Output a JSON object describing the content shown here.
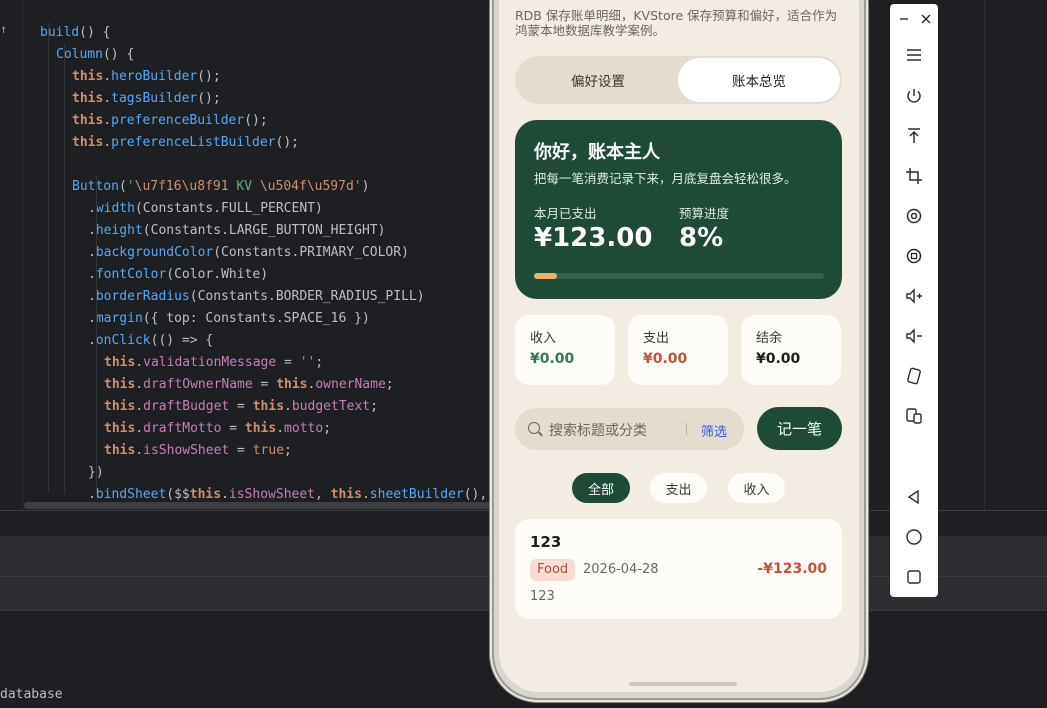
{
  "ide": {
    "code_lines": [
      {
        "indent": 0,
        "tokens": [
          [
            "fn",
            "build"
          ],
          [
            "pl",
            "() {"
          ]
        ]
      },
      {
        "indent": 1,
        "tokens": [
          [
            "fn",
            "Column"
          ],
          [
            "pl",
            "() {"
          ]
        ]
      },
      {
        "indent": 2,
        "tokens": [
          [
            "this",
            "this"
          ],
          [
            "pl",
            "."
          ],
          [
            "fn",
            "heroBuilder"
          ],
          [
            "pl",
            "();"
          ]
        ]
      },
      {
        "indent": 2,
        "tokens": [
          [
            "this",
            "this"
          ],
          [
            "pl",
            "."
          ],
          [
            "fn",
            "tagsBuilder"
          ],
          [
            "pl",
            "();"
          ]
        ]
      },
      {
        "indent": 2,
        "tokens": [
          [
            "this",
            "this"
          ],
          [
            "pl",
            "."
          ],
          [
            "fn",
            "preferenceBuilder"
          ],
          [
            "pl",
            "();"
          ]
        ]
      },
      {
        "indent": 2,
        "tokens": [
          [
            "this",
            "this"
          ],
          [
            "pl",
            "."
          ],
          [
            "fn",
            "preferenceListBuilder"
          ],
          [
            "pl",
            "();"
          ]
        ]
      },
      {
        "indent": 2,
        "tokens": []
      },
      {
        "indent": 2,
        "tokens": [
          [
            "fn",
            "Button"
          ],
          [
            "pl",
            "("
          ],
          [
            "str",
            "'"
          ],
          [
            "esc",
            "\\u7f16\\u8f91"
          ],
          [
            "str",
            " KV "
          ],
          [
            "esc",
            "\\u504f\\u597d"
          ],
          [
            "str",
            "'"
          ],
          [
            "pl",
            ")"
          ]
        ]
      },
      {
        "indent": 3,
        "tokens": [
          [
            "pl",
            "."
          ],
          [
            "fn",
            "width"
          ],
          [
            "pl",
            "(Constants.FULL_PERCENT)"
          ]
        ]
      },
      {
        "indent": 3,
        "tokens": [
          [
            "pl",
            "."
          ],
          [
            "fn",
            "height"
          ],
          [
            "pl",
            "(Constants.LARGE_BUTTON_HEIGHT)"
          ]
        ]
      },
      {
        "indent": 3,
        "tokens": [
          [
            "pl",
            "."
          ],
          [
            "fn",
            "backgroundColor"
          ],
          [
            "pl",
            "(Constants.PRIMARY_COLOR)"
          ]
        ]
      },
      {
        "indent": 3,
        "tokens": [
          [
            "pl",
            "."
          ],
          [
            "fn",
            "fontColor"
          ],
          [
            "pl",
            "(Color.White)"
          ]
        ]
      },
      {
        "indent": 3,
        "tokens": [
          [
            "pl",
            "."
          ],
          [
            "fn",
            "borderRadius"
          ],
          [
            "pl",
            "(Constants.BORDER_RADIUS_PILL)"
          ]
        ]
      },
      {
        "indent": 3,
        "tokens": [
          [
            "pl",
            "."
          ],
          [
            "fn",
            "margin"
          ],
          [
            "pl",
            "({ top: Constants.SPACE_16 })"
          ]
        ]
      },
      {
        "indent": 3,
        "tokens": [
          [
            "pl",
            "."
          ],
          [
            "fn",
            "onClick"
          ],
          [
            "pl",
            "(() => {"
          ]
        ]
      },
      {
        "indent": 4,
        "tokens": [
          [
            "this",
            "this"
          ],
          [
            "pl",
            "."
          ],
          [
            "prop",
            "validationMessage"
          ],
          [
            "pl",
            " = "
          ],
          [
            "str",
            "''"
          ],
          [
            "pl",
            ";"
          ]
        ]
      },
      {
        "indent": 4,
        "tokens": [
          [
            "this",
            "this"
          ],
          [
            "pl",
            "."
          ],
          [
            "prop",
            "draftOwnerName"
          ],
          [
            "pl",
            " = "
          ],
          [
            "this",
            "this"
          ],
          [
            "pl",
            "."
          ],
          [
            "prop",
            "ownerName"
          ],
          [
            "pl",
            ";"
          ]
        ]
      },
      {
        "indent": 4,
        "tokens": [
          [
            "this",
            "this"
          ],
          [
            "pl",
            "."
          ],
          [
            "prop",
            "draftBudget"
          ],
          [
            "pl",
            " = "
          ],
          [
            "this",
            "this"
          ],
          [
            "pl",
            "."
          ],
          [
            "prop",
            "budgetText"
          ],
          [
            "pl",
            ";"
          ]
        ]
      },
      {
        "indent": 4,
        "tokens": [
          [
            "this",
            "this"
          ],
          [
            "pl",
            "."
          ],
          [
            "prop",
            "draftMotto"
          ],
          [
            "pl",
            " = "
          ],
          [
            "this",
            "this"
          ],
          [
            "pl",
            "."
          ],
          [
            "prop",
            "motto"
          ],
          [
            "pl",
            ";"
          ]
        ]
      },
      {
        "indent": 4,
        "tokens": [
          [
            "this",
            "this"
          ],
          [
            "pl",
            "."
          ],
          [
            "prop",
            "isShowSheet"
          ],
          [
            "pl",
            " = "
          ],
          [
            "kw",
            "true"
          ],
          [
            "pl",
            ";"
          ]
        ]
      },
      {
        "indent": 3,
        "tokens": [
          [
            "pl",
            "})"
          ]
        ]
      },
      {
        "indent": 3,
        "tokens": [
          [
            "pl",
            "."
          ],
          [
            "fn",
            "bindSheet"
          ],
          [
            "pl",
            "($$"
          ],
          [
            "this",
            "this"
          ],
          [
            "pl",
            "."
          ],
          [
            "prop",
            "isShowSheet"
          ],
          [
            "pl",
            ", "
          ],
          [
            "this",
            "this"
          ],
          [
            "pl",
            "."
          ],
          [
            "fn",
            "sheetBuilder"
          ],
          [
            "pl",
            "(),"
          ]
        ]
      }
    ],
    "terminal_text": "database"
  },
  "app": {
    "description": "RDB 保存账单明细，KVStore 保存预算和偏好，适合作为鸿蒙本地数据库教学案例。",
    "tabs": [
      "偏好设置",
      "账本总览"
    ],
    "hero": {
      "title": "你好，账本主人",
      "subtitle": "把每一笔消费记录下来，月底复盘会轻松很多。",
      "spent_label": "本月已支出",
      "spent_value": "¥123.00",
      "progress_label": "预算进度",
      "progress_value": "8%",
      "progress_fraction": 0.08
    },
    "stats": [
      {
        "label": "收入",
        "value": "¥0.00",
        "color": "#2f7a4f"
      },
      {
        "label": "支出",
        "value": "¥0.00",
        "color": "#c0533a"
      },
      {
        "label": "结余",
        "value": "¥0.00",
        "color": "#1f1e1c"
      }
    ],
    "search": {
      "placeholder": "搜索标题或分类",
      "filter": "筛选"
    },
    "add_button": "记一笔",
    "filters": [
      "全部",
      "支出",
      "收入"
    ],
    "records": [
      {
        "title": "123",
        "tag": "Food",
        "date": "2026-04-28",
        "amount": "-¥123.00",
        "note": "123"
      }
    ]
  },
  "toolbar": {
    "icons": [
      "menu-icon",
      "power-icon",
      "upload-icon",
      "crop-icon",
      "rotate-icon",
      "screen-capture-icon",
      "volume-up-icon",
      "volume-down-icon",
      "flip-icon",
      "multi-screen-icon",
      "back-icon",
      "home-icon",
      "recents-icon"
    ]
  },
  "colors": {
    "primary": "#1f4a37",
    "accent": "#e8b46a",
    "background": "#f2ece3"
  }
}
